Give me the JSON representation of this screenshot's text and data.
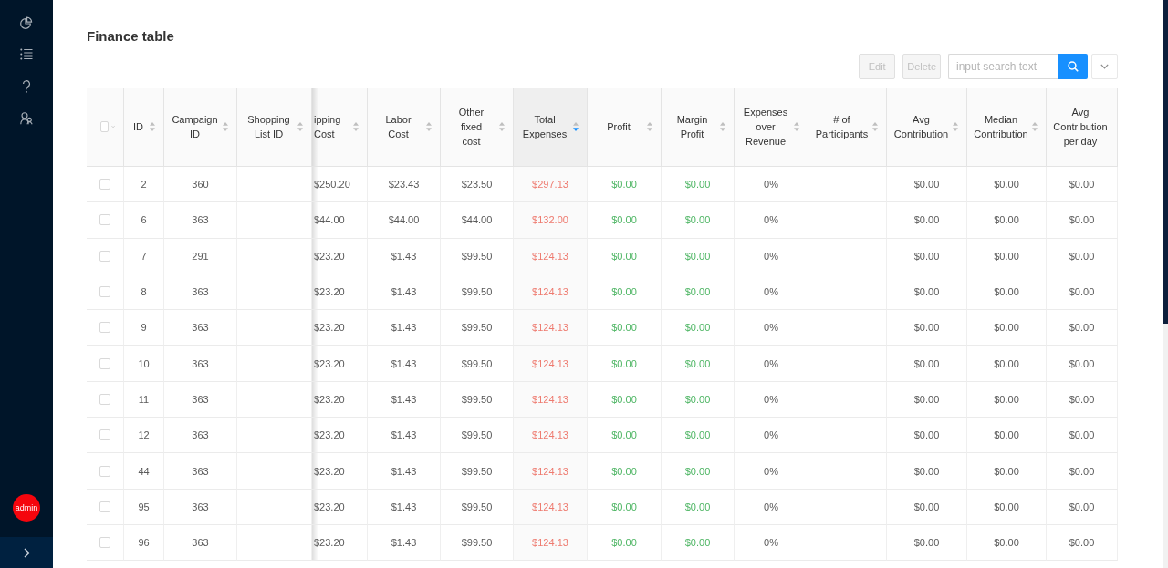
{
  "sidebar": {
    "collapsed": true,
    "items": [
      {
        "selected": false
      },
      {
        "selected": false
      },
      {
        "selected": false
      },
      {
        "selected": false
      }
    ],
    "avatar": {
      "label": "admin"
    }
  },
  "page": {
    "title": "Finance table"
  },
  "toolbar": {
    "buttons": [
      {
        "label": "Edit",
        "disabled": true
      },
      {
        "label": "Delete",
        "disabled": true
      }
    ],
    "search": {
      "placeholder": "input search text"
    }
  },
  "table": {
    "select_all": {
      "checked": false
    },
    "columns": [
      {
        "label": "ID",
        "kind": "plain",
        "sortable": true,
        "sort_ascending": false,
        "sort_descending": false
      },
      {
        "label": "Campaign ID",
        "kind": "plain",
        "sortable": true,
        "sort_ascending": false,
        "sort_descending": false
      },
      {
        "label": "Shopping List ID",
        "sortable": true,
        "sort_ascending": false,
        "sort_descending": false
      },
      {
        "label": "ipping Cost",
        "kind": "plain",
        "sortable": true,
        "sort_ascending": false,
        "sort_descending": false
      },
      {
        "label": "Labor Cost",
        "kind": "plain",
        "sortable": true,
        "sort_ascending": false,
        "sort_descending": false
      },
      {
        "label": "Other fixed cost",
        "kind": "plain",
        "sortable": true,
        "sort_ascending": false,
        "sort_descending": false
      },
      {
        "label": "Total Expenses",
        "kind": "expense",
        "sortable": true,
        "sort_ascending": false,
        "sort_descending": true
      },
      {
        "label": "Profit",
        "kind": "income",
        "sortable": true,
        "sort_ascending": false,
        "sort_descending": false
      },
      {
        "label": "Margin Profit",
        "kind": "income",
        "sortable": true,
        "sort_ascending": false,
        "sort_descending": false
      },
      {
        "label": "Expenses over Revenue",
        "kind": "plain",
        "sortable": true,
        "sort_ascending": false,
        "sort_descending": false
      },
      {
        "label": "# of Participants",
        "sortable": true,
        "sort_ascending": false,
        "sort_descending": false
      },
      {
        "label": "Avg Contribution",
        "kind": "plain",
        "sortable": true,
        "sort_ascending": false,
        "sort_descending": false
      },
      {
        "label": "Median Contribution",
        "kind": "plain",
        "sortable": true,
        "sort_ascending": false,
        "sort_descending": false
      },
      {
        "label": "Avg Contribution per day",
        "kind": "plain",
        "sortable": false
      }
    ],
    "rows": [
      {
        "selected": false,
        "cells": [
          "2",
          "360",
          null,
          "$250.20",
          "$23.43",
          "$23.50",
          "$297.13",
          "$0.00",
          "$0.00",
          "0%",
          null,
          "$0.00",
          "$0.00",
          "$0.00"
        ]
      },
      {
        "selected": false,
        "cells": [
          "6",
          "363",
          null,
          "$44.00",
          "$44.00",
          "$44.00",
          "$132.00",
          "$0.00",
          "$0.00",
          "0%",
          null,
          "$0.00",
          "$0.00",
          "$0.00"
        ]
      },
      {
        "selected": false,
        "cells": [
          "7",
          "291",
          null,
          "$23.20",
          "$1.43",
          "$99.50",
          "$124.13",
          "$0.00",
          "$0.00",
          "0%",
          null,
          "$0.00",
          "$0.00",
          "$0.00"
        ]
      },
      {
        "selected": false,
        "cells": [
          "8",
          "363",
          null,
          "$23.20",
          "$1.43",
          "$99.50",
          "$124.13",
          "$0.00",
          "$0.00",
          "0%",
          null,
          "$0.00",
          "$0.00",
          "$0.00"
        ]
      },
      {
        "selected": false,
        "cells": [
          "9",
          "363",
          null,
          "$23.20",
          "$1.43",
          "$99.50",
          "$124.13",
          "$0.00",
          "$0.00",
          "0%",
          null,
          "$0.00",
          "$0.00",
          "$0.00"
        ]
      },
      {
        "selected": false,
        "cells": [
          "10",
          "363",
          null,
          "$23.20",
          "$1.43",
          "$99.50",
          "$124.13",
          "$0.00",
          "$0.00",
          "0%",
          null,
          "$0.00",
          "$0.00",
          "$0.00"
        ]
      },
      {
        "selected": false,
        "cells": [
          "11",
          "363",
          null,
          "$23.20",
          "$1.43",
          "$99.50",
          "$124.13",
          "$0.00",
          "$0.00",
          "0%",
          null,
          "$0.00",
          "$0.00",
          "$0.00"
        ]
      },
      {
        "selected": false,
        "cells": [
          "12",
          "363",
          null,
          "$23.20",
          "$1.43",
          "$99.50",
          "$124.13",
          "$0.00",
          "$0.00",
          "0%",
          null,
          "$0.00",
          "$0.00",
          "$0.00"
        ]
      },
      {
        "selected": false,
        "cells": [
          "44",
          "363",
          null,
          "$23.20",
          "$1.43",
          "$99.50",
          "$124.13",
          "$0.00",
          "$0.00",
          "0%",
          null,
          "$0.00",
          "$0.00",
          "$0.00"
        ]
      },
      {
        "selected": false,
        "cells": [
          "95",
          "363",
          null,
          "$23.20",
          "$1.43",
          "$99.50",
          "$124.13",
          "$0.00",
          "$0.00",
          "0%",
          null,
          "$0.00",
          "$0.00",
          "$0.00"
        ]
      },
      {
        "selected": false,
        "cells": [
          "96",
          "363",
          null,
          "$23.20",
          "$1.43",
          "$99.50",
          "$124.13",
          "$0.00",
          "$0.00",
          "0%",
          null,
          "$0.00",
          "$0.00",
          "$0.00"
        ]
      }
    ]
  }
}
